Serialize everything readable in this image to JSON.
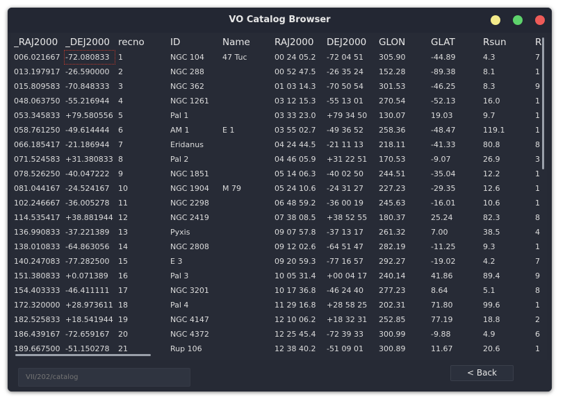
{
  "window": {
    "title": "VO Catalog Browser"
  },
  "table": {
    "columns": [
      "_RAJ2000",
      "_DEJ2000",
      "recno",
      "ID",
      "Name",
      "RAJ2000",
      "DEJ2000",
      "GLON",
      "GLAT",
      "Rsun",
      "R"
    ],
    "selected": {
      "row": 0,
      "col": 1
    },
    "rows": [
      [
        "006.021667",
        "-72.080833",
        "1",
        "NGC 104",
        "47 Tuc",
        "00 24 05.2",
        "-72 04 51",
        "305.90",
        "-44.89",
        "4.3",
        "7"
      ],
      [
        "013.197917",
        "-26.590000",
        "2",
        "NGC 288",
        "",
        "00 52 47.5",
        "-26 35 24",
        "152.28",
        "-89.38",
        "8.1",
        "1"
      ],
      [
        "015.809583",
        "-70.848333",
        "3",
        "NGC 362",
        "",
        "01 03 14.3",
        "-70 50 54",
        "301.53",
        "-46.25",
        "8.3",
        "9"
      ],
      [
        "048.063750",
        "-55.216944",
        "4",
        "NGC 1261",
        "",
        "03 12 15.3",
        "-55 13 01",
        "270.54",
        "-52.13",
        "16.0",
        "1"
      ],
      [
        "053.345833",
        "+79.580556",
        "5",
        "Pal 1",
        "",
        "03 33 23.0",
        "+79 34 50",
        "130.07",
        "19.03",
        "9.7",
        "1"
      ],
      [
        "058.761250",
        "-49.614444",
        "6",
        "AM 1",
        "E 1",
        "03 55 02.7",
        "-49 36 52",
        "258.36",
        "-48.47",
        "119.1",
        "1"
      ],
      [
        "066.185417",
        "-21.186944",
        "7",
        "Eridanus",
        "",
        "04 24 44.5",
        "-21 11 13",
        "218.11",
        "-41.33",
        "80.8",
        "8"
      ],
      [
        "071.524583",
        "+31.380833",
        "8",
        "Pal 2",
        "",
        "04 46 05.9",
        "+31 22 51",
        "170.53",
        "-9.07",
        "26.9",
        "3"
      ],
      [
        "078.526250",
        "-40.047222",
        "9",
        "NGC 1851",
        "",
        "05 14 06.3",
        "-40 02 50",
        "244.51",
        "-35.04",
        "12.2",
        "1"
      ],
      [
        "081.044167",
        "-24.524167",
        "10",
        "NGC 1904",
        "M 79",
        "05 24 10.6",
        "-24 31 27",
        "227.23",
        "-29.35",
        "12.6",
        "1"
      ],
      [
        "102.246667",
        "-36.005278",
        "11",
        "NGC 2298",
        "",
        "06 48 59.2",
        "-36 00 19",
        "245.63",
        "-16.01",
        "10.6",
        "1"
      ],
      [
        "114.535417",
        "+38.881944",
        "12",
        "NGC 2419",
        "",
        "07 38 08.5",
        "+38 52 55",
        "180.37",
        "25.24",
        "82.3",
        "8"
      ],
      [
        "136.990833",
        "-37.221389",
        "13",
        "Pyxis",
        "",
        "09 07 57.8",
        "-37 13 17",
        "261.32",
        "7.00",
        "38.5",
        "4"
      ],
      [
        "138.010833",
        "-64.863056",
        "14",
        "NGC 2808",
        "",
        "09 12 02.6",
        "-64 51 47",
        "282.19",
        "-11.25",
        "9.3",
        "1"
      ],
      [
        "140.247083",
        "-77.282500",
        "15",
        "E 3",
        "",
        "09 20 59.3",
        "-77 16 57",
        "292.27",
        "-19.02",
        "4.2",
        "7"
      ],
      [
        "151.380833",
        "+0.071389",
        "16",
        "Pal 3",
        "",
        "10 05 31.4",
        "+00 04 17",
        "240.14",
        "41.86",
        "89.4",
        "9"
      ],
      [
        "154.403333",
        "-46.411111",
        "17",
        "NGC 3201",
        "",
        "10 17 36.8",
        "-46 24 40",
        "277.23",
        "8.64",
        "5.1",
        "8"
      ],
      [
        "172.320000",
        "+28.973611",
        "18",
        "Pal 4",
        "",
        "11 29 16.8",
        "+28 58 25",
        "202.31",
        "71.80",
        "99.6",
        "1"
      ],
      [
        "182.525833",
        "+18.541944",
        "19",
        "NGC 4147",
        "",
        "12 10 06.2",
        "+18 32 31",
        "252.85",
        "77.19",
        "18.8",
        "2"
      ],
      [
        "186.439167",
        "-72.659167",
        "20",
        "NGC 4372",
        "",
        "12 25 45.4",
        "-72 39 33",
        "300.99",
        "-9.88",
        "4.9",
        "6"
      ],
      [
        "189.667500",
        "-51.150278",
        "21",
        "Rup 106",
        "",
        "12 38 40.2",
        "-51 09 01",
        "300.89",
        "11.67",
        "20.6",
        "1"
      ]
    ]
  },
  "footer": {
    "path_placeholder": "VII/202/catalog",
    "back_label": "< Back"
  }
}
